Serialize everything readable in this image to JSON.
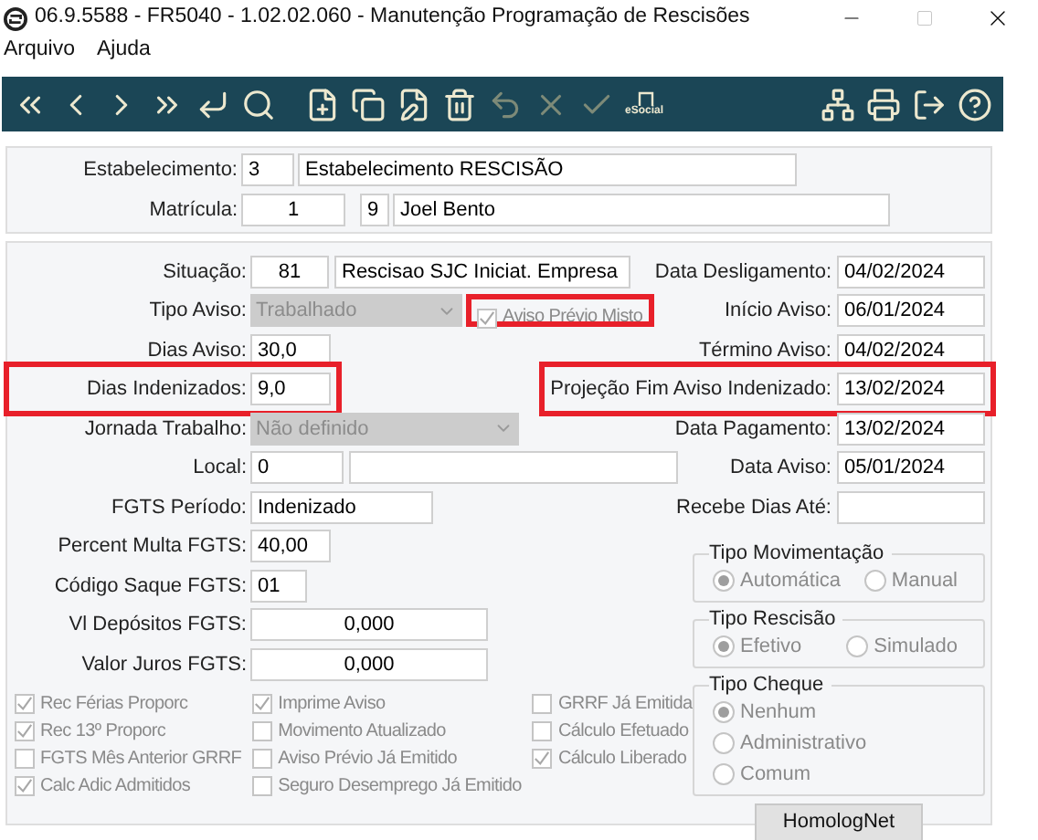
{
  "window": {
    "title": "06.9.5588 - FR5040 - 1.02.02.060 - Manutenção Programação de Rescisões"
  },
  "menu": [
    "Arquivo",
    "Ajuda"
  ],
  "toolbar": [
    {
      "kind": "first",
      "disabled": false
    },
    {
      "kind": "prev",
      "disabled": false
    },
    {
      "kind": "next",
      "disabled": false
    },
    {
      "kind": "last",
      "disabled": false
    },
    {
      "kind": "enter",
      "disabled": false
    },
    {
      "kind": "search",
      "disabled": false
    },
    {
      "kind": "new",
      "disabled": false
    },
    {
      "kind": "copy",
      "disabled": false
    },
    {
      "kind": "edit",
      "disabled": false
    },
    {
      "kind": "delete",
      "disabled": false
    },
    {
      "kind": "undo",
      "disabled": true
    },
    {
      "kind": "cancel",
      "disabled": true
    },
    {
      "kind": "confirm",
      "disabled": true
    },
    {
      "kind": "esocial",
      "label": "eSocial",
      "disabled": false
    },
    {
      "kind": "tree",
      "disabled": false
    },
    {
      "kind": "print",
      "disabled": false
    },
    {
      "kind": "exit",
      "disabled": false
    },
    {
      "kind": "help",
      "disabled": false
    }
  ],
  "header": {
    "estabelecimento": {
      "label": "Estabelecimento:",
      "code": "3",
      "name": "Estabelecimento RESCISÃO"
    },
    "matricula": {
      "label": "Matrícula:",
      "code": "1",
      "digit": "9",
      "name": "Joel Bento"
    }
  },
  "left_fields": [
    {
      "kind": "pair",
      "label": "Situação:",
      "values": [
        "81",
        "Rescisao SJC Iniciat. Empresa"
      ],
      "highlighted": false
    },
    {
      "kind": "select",
      "label": "Tipo Aviso:",
      "values": [
        "Trabalhado"
      ],
      "disabled": true,
      "highlighted": false,
      "checkbox": {
        "label": "Aviso Prévio Misto",
        "checked": true,
        "disabled": true,
        "highlighted": true
      }
    },
    {
      "kind": "text",
      "label": "Dias Aviso:",
      "values": [
        "30,0"
      ],
      "highlighted": false
    },
    {
      "kind": "text",
      "label": "Dias Indenizados:",
      "values": [
        "9,0"
      ],
      "highlighted": true
    },
    {
      "kind": "select",
      "label": "Jornada Trabalho:",
      "values": [
        "Não definido"
      ],
      "disabled": true,
      "highlighted": false
    },
    {
      "kind": "code_blank",
      "label": "Local:",
      "values": [
        "0"
      ],
      "highlighted": false
    },
    {
      "kind": "text",
      "label": "FGTS Período:",
      "values": [
        "Indenizado"
      ],
      "highlighted": false
    },
    {
      "kind": "text",
      "label": "Percent Multa FGTS:",
      "values": [
        "40,00"
      ],
      "highlighted": false
    },
    {
      "kind": "text",
      "label": "Código Saque FGTS:",
      "values": [
        "01"
      ],
      "highlighted": false
    },
    {
      "kind": "text",
      "label": "Vl Depósitos FGTS:",
      "values": [
        "0,000"
      ],
      "highlighted": false
    },
    {
      "kind": "text",
      "label": "Valor Juros FGTS:",
      "values": [
        "0,000"
      ],
      "highlighted": false
    }
  ],
  "right_fields": [
    {
      "label": "Data Desligamento:",
      "value": "04/02/2024",
      "highlighted": false
    },
    {
      "label": "Início Aviso:",
      "value": "06/01/2024",
      "highlighted": false
    },
    {
      "label": "Término Aviso:",
      "value": "04/02/2024",
      "highlighted": false
    },
    {
      "label": "Projeção Fim Aviso Indenizado:",
      "value": "13/02/2024",
      "highlighted": true
    },
    {
      "label": "Data Pagamento:",
      "value": "13/02/2024",
      "highlighted": false
    },
    {
      "label": "Data Aviso:",
      "value": "05/01/2024",
      "highlighted": false
    },
    {
      "label": "Recebe Dias Até:",
      "highlighted": false
    }
  ],
  "radio_groups": [
    {
      "kind": "row",
      "title": "Tipo Movimentação",
      "options": [
        {
          "label": "Automática",
          "selected": true
        },
        {
          "label": "Manual",
          "selected": false
        }
      ]
    },
    {
      "kind": "row",
      "title": "Tipo Rescisão",
      "options": [
        {
          "label": "Efetivo",
          "selected": true
        },
        {
          "label": "Simulado",
          "selected": false
        }
      ]
    },
    {
      "kind": "column",
      "title": "Tipo Cheque",
      "options": [
        {
          "label": "Nenhum",
          "selected": true
        },
        {
          "label": "Administrativo",
          "selected": false
        },
        {
          "label": "Comum",
          "selected": false
        }
      ]
    }
  ],
  "checkbox_columns": [
    [
      {
        "label": "Rec Férias Proporc",
        "checked": true
      },
      {
        "label": "Rec 13º Proporc",
        "checked": true
      },
      {
        "label": "FGTS Mês Anterior GRRF",
        "checked": false
      },
      {
        "label": "Calc Adic Admitidos",
        "checked": true
      }
    ],
    [
      {
        "label": "Imprime Aviso",
        "checked": true
      },
      {
        "label": "Movimento Atualizado",
        "checked": false
      },
      {
        "label": "Aviso Prévio Já Emitido",
        "checked": false
      },
      {
        "label": "Seguro Desemprego Já Emitido",
        "checked": false
      }
    ],
    [
      {
        "label": "GRRF Já Emitida",
        "checked": false
      },
      {
        "label": "Cálculo Efetuado",
        "checked": false
      },
      {
        "label": "Cálculo Liberado",
        "checked": true
      }
    ]
  ],
  "button": "HomologNet"
}
